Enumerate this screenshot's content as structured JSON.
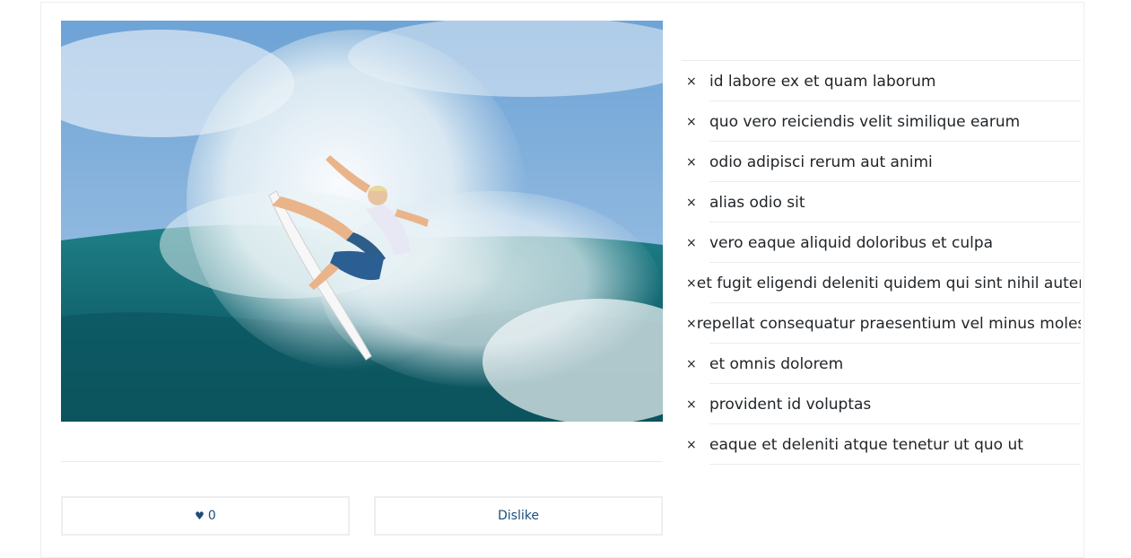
{
  "post": {
    "image_alt": "surfer riding a wave"
  },
  "actions": {
    "like_icon": "heart-icon",
    "like_count": "0",
    "dislike_label": "Dislike"
  },
  "list": {
    "remove_symbol": "×",
    "items": [
      {
        "label": "id labore ex et quam laborum"
      },
      {
        "label": "quo vero reiciendis velit similique earum"
      },
      {
        "label": "odio adipisci rerum aut animi"
      },
      {
        "label": "alias odio sit"
      },
      {
        "label": "vero eaque aliquid doloribus et culpa"
      },
      {
        "label": "et fugit eligendi deleniti quidem qui sint nihil autem"
      },
      {
        "label": "repellat consequatur praesentium vel minus molestias voluptatum"
      },
      {
        "label": "et omnis dolorem"
      },
      {
        "label": "provident id voluptas"
      },
      {
        "label": "eaque et deleniti atque tenetur ut quo ut"
      }
    ]
  },
  "colors": {
    "accent": "#1d4e79",
    "border": "#eeeeee",
    "divider": "#e9ecef"
  }
}
